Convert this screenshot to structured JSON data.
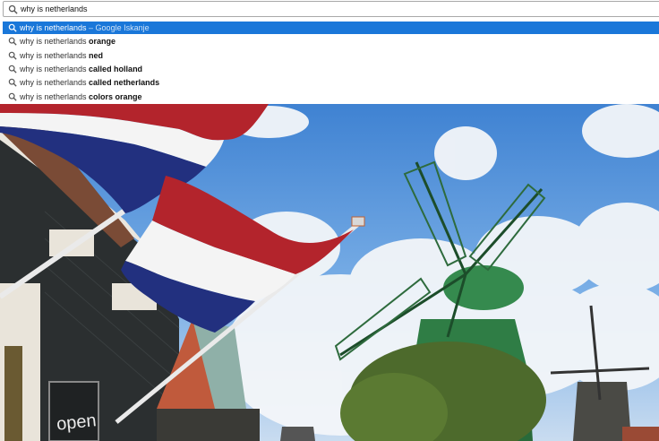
{
  "omnibox": {
    "query": "why is netherlands",
    "icon": "search-icon"
  },
  "suggestions": [
    {
      "prefix": "why is netherlands",
      "bold": "",
      "suffix": " – Google Iskanje",
      "selected": true
    },
    {
      "prefix": "why is netherlands ",
      "bold": "orange",
      "suffix": "",
      "selected": false
    },
    {
      "prefix": "why is netherlands ",
      "bold": "ned",
      "suffix": "",
      "selected": false
    },
    {
      "prefix": "why is netherlands ",
      "bold": "called holland",
      "suffix": "",
      "selected": false
    },
    {
      "prefix": "why is netherlands ",
      "bold": "called netherlands",
      "suffix": "",
      "selected": false
    },
    {
      "prefix": "why is netherlands ",
      "bold": "colors orange",
      "suffix": "",
      "selected": false
    }
  ],
  "photo": {
    "sign_text": "open",
    "colors": {
      "sky": "#4f8ed6",
      "flag_red": "#b3242c",
      "flag_white": "#f4f4f4",
      "flag_blue": "#22307f",
      "mill_green": "#2f7d45"
    }
  },
  "colors": {
    "highlight": "#1a77d9"
  }
}
